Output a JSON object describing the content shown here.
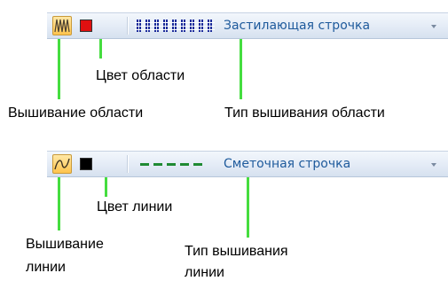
{
  "area_toolbar": {
    "stitch_type_text": "Застилающая строчка",
    "fill_color": "#e01010",
    "icons": {
      "mode": "area-sewing-icon",
      "pattern": "fill-stitch-pattern-icon",
      "dropdown": "dropdown-arrow-icon"
    }
  },
  "line_toolbar": {
    "stitch_type_text": "Сметочная строчка",
    "line_color": "#000000",
    "icons": {
      "mode": "line-sewing-icon",
      "pattern": "running-stitch-pattern-icon",
      "dropdown": "dropdown-arrow-icon"
    }
  },
  "callouts": {
    "area_sewing": "Вышивание области",
    "area_color": "Цвет области",
    "area_sew_type": "Тип вышивания области",
    "line_sewing_1": "Вышивание",
    "line_sewing_2": "линии",
    "line_color": "Цвет линии",
    "line_sew_type_1": "Тип вышивания",
    "line_sew_type_2": "линии"
  },
  "colors": {
    "leader": "#45dd3f",
    "active_button": "#ffc44d",
    "combo_text": "#1e5a9c"
  }
}
